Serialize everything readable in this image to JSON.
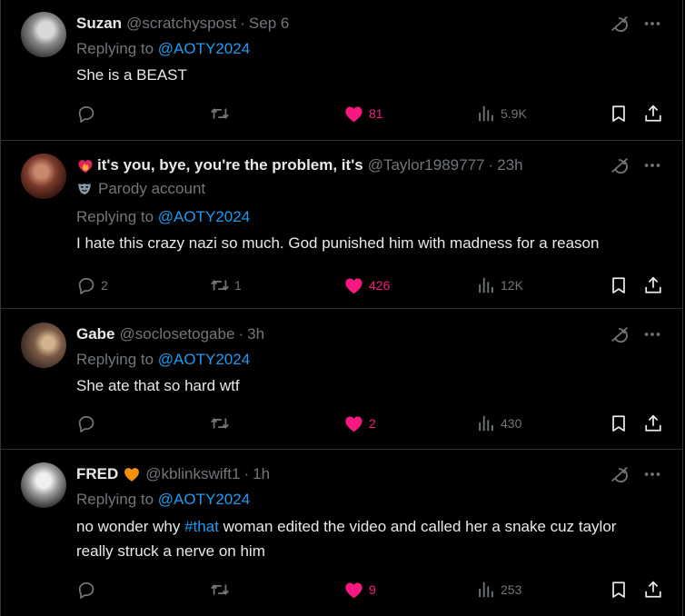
{
  "colors": {
    "background": "#000000",
    "text": "#e7e9ea",
    "muted": "#71767b",
    "link": "#1d9bf0",
    "like": "#f91880",
    "divider": "#2f3336",
    "heart_badge": "#f4900c"
  },
  "posts": [
    {
      "name": "Suzan",
      "handle": "@scratchyspost",
      "time": "Sep 6",
      "replying_prefix": "Replying to ",
      "mention": "@AOTY2024",
      "text": "She is a BEAST",
      "replies": "",
      "reposts": "",
      "likes": "81",
      "views": "5.9K",
      "liked": true
    },
    {
      "name": "it's you, bye, you're the problem, it's",
      "handle": "@Taylor1989777",
      "time": "23h",
      "parody_label": "Parody account",
      "replying_prefix": "Replying to ",
      "mention": "@AOTY2024",
      "text": "I hate this crazy nazi so much. God punished him with madness for a reason",
      "replies": "2",
      "reposts": "1",
      "likes": "426",
      "views": "12K",
      "liked": true
    },
    {
      "name": "Gabe",
      "handle": "@soclosetogabe",
      "time": "3h",
      "replying_prefix": "Replying to ",
      "mention": "@AOTY2024",
      "text": "She ate that so hard wtf",
      "replies": "",
      "reposts": "",
      "likes": "2",
      "views": "430",
      "liked": true
    },
    {
      "name": "FRED",
      "handle": "@kblinkswift1",
      "time": "1h",
      "replying_prefix": "Replying to ",
      "mention": "@AOTY2024",
      "text_before": "no wonder why ",
      "hashtag": "#that",
      "text_after": " woman edited the video and called her a snake cuz taylor really struck a nerve on him",
      "replies": "",
      "reposts": "",
      "likes": "9",
      "views": "253",
      "liked": true
    }
  ],
  "separator_dot": "·",
  "icons": [
    "grok-icon",
    "more-icon",
    "reply-icon",
    "repost-icon",
    "like-icon",
    "views-icon",
    "bookmark-icon",
    "share-icon",
    "fire-heart-icon",
    "mask-icon",
    "orange-heart-icon"
  ]
}
